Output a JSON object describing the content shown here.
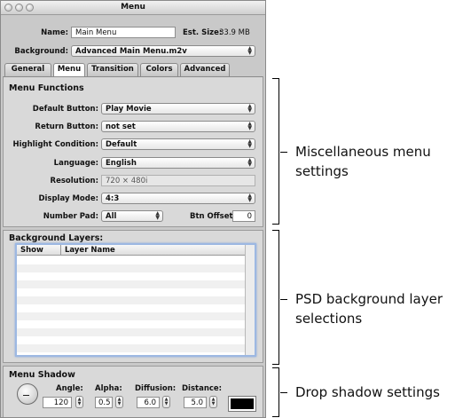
{
  "window": {
    "title": "Menu",
    "name_label": "Name:",
    "name_value": "Main Menu",
    "est_size_label": "Est. Size:",
    "est_size_value": "33.9 MB",
    "background_label": "Background:",
    "background_value": "Advanced Main Menu.m2v"
  },
  "tabs": [
    {
      "label": "General"
    },
    {
      "label": "Menu"
    },
    {
      "label": "Transition"
    },
    {
      "label": "Colors"
    },
    {
      "label": "Advanced"
    }
  ],
  "menu_functions": {
    "title": "Menu Functions",
    "default_button_label": "Default Button:",
    "default_button_value": "Play Movie",
    "return_button_label": "Return Button:",
    "return_button_value": "not set",
    "highlight_label": "Highlight Condition:",
    "highlight_value": "Default",
    "language_label": "Language:",
    "language_value": "English",
    "resolution_label": "Resolution:",
    "resolution_value": "720 × 480i",
    "display_mode_label": "Display Mode:",
    "display_mode_value": "4:3",
    "number_pad_label": "Number Pad:",
    "number_pad_value": "All",
    "btn_offset_label": "Btn Offset:",
    "btn_offset_value": "0"
  },
  "background_layers": {
    "title": "Background Layers:",
    "col_show": "Show",
    "col_layer_name": "Layer Name"
  },
  "menu_shadow": {
    "title": "Menu Shadow",
    "angle_label": "Angle:",
    "angle_value": "120",
    "alpha_label": "Alpha:",
    "alpha_value": "0.5",
    "diffusion_label": "Diffusion:",
    "diffusion_value": "6.0",
    "distance_label": "Distance:",
    "distance_value": "5.0",
    "shadow_color": "#000000"
  },
  "callouts": {
    "misc": [
      "Miscellaneous menu",
      "settings"
    ],
    "psd": [
      "PSD background layer",
      "selections"
    ],
    "drop": [
      "Drop shadow settings"
    ]
  }
}
